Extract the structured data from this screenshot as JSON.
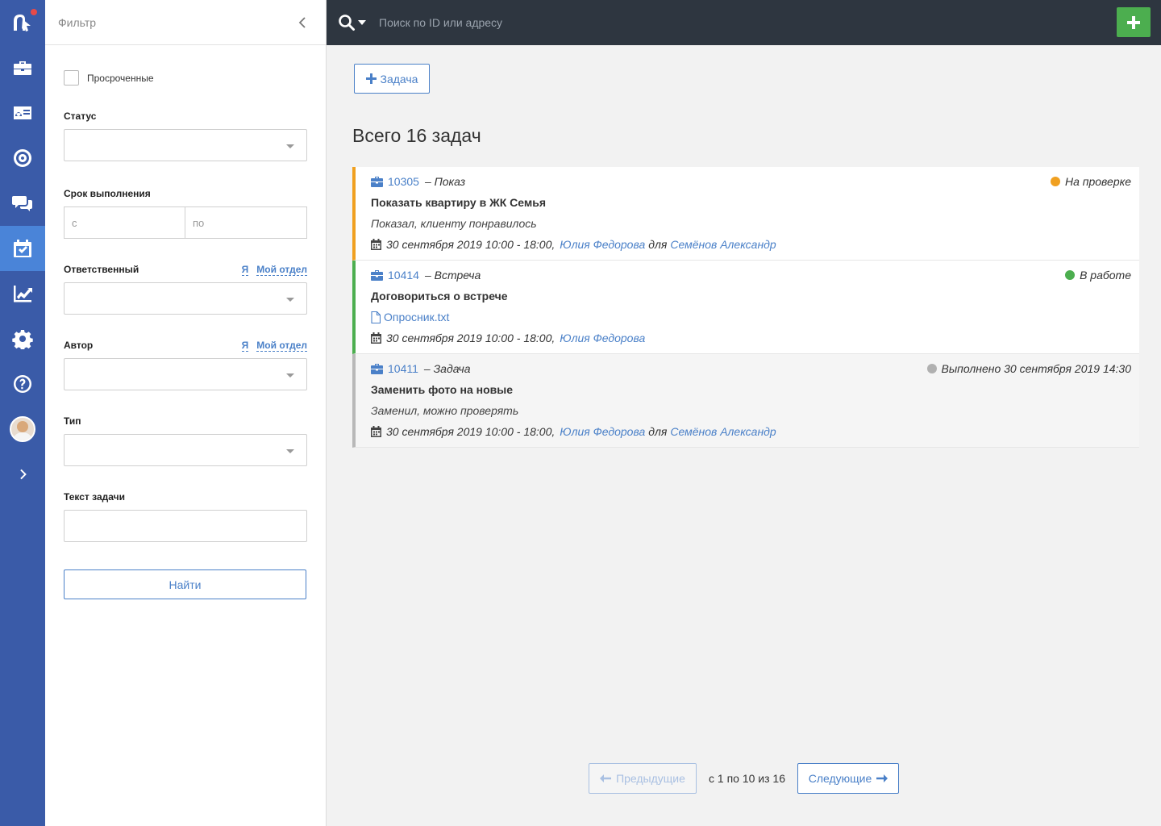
{
  "sidebar": {
    "items": [
      {
        "name": "briefcase-icon"
      },
      {
        "name": "contact-card-icon"
      },
      {
        "name": "target-icon"
      },
      {
        "name": "chat-icon"
      },
      {
        "name": "calendar-check-icon",
        "active": true
      },
      {
        "name": "chart-icon"
      },
      {
        "name": "gear-icon"
      },
      {
        "name": "help-icon"
      },
      {
        "name": "avatar"
      },
      {
        "name": "expand-icon"
      }
    ],
    "accent": "#3a5ba8",
    "active_color": "#4a84d8"
  },
  "filter": {
    "title": "Фильтр",
    "overdue_label": "Просроченные",
    "status_label": "Статус",
    "deadline_label": "Срок выполнения",
    "deadline_from_placeholder": "с",
    "deadline_to_placeholder": "по",
    "responsible_label": "Ответственный",
    "author_label": "Автор",
    "me_link": "Я",
    "my_dept_link": "Мой отдел",
    "type_label": "Тип",
    "text_label": "Текст задачи",
    "find_button": "Найти"
  },
  "topbar": {
    "search_placeholder": "Поиск по ID или адресу",
    "add_label": "+"
  },
  "main": {
    "new_task_button": "Задача",
    "total_title": "Всего 16 задач",
    "tasks": [
      {
        "id": "10305",
        "type": "– Показ",
        "status": "На проверке",
        "status_color": "#f0a020",
        "border_color": "#f0a020",
        "title": "Показать квартиру в ЖК Семья",
        "comment": "Показал, клиенту понравилось",
        "date": "30 сентября 2019 10:00 - 18:00,",
        "assignee": "Юлия Федорова",
        "for_word": "для",
        "client": "Семёнов Александр"
      },
      {
        "id": "10414",
        "type": "– Встреча",
        "status": "В работе",
        "status_color": "#4cae4f",
        "border_color": "#4cae4f",
        "title": "Договориться о встрече",
        "file": "Опросник.txt",
        "date": "30 сентября 2019 10:00 - 18:00,",
        "assignee": "Юлия Федорова"
      },
      {
        "id": "10411",
        "type": "– Задача",
        "status": "Выполнено 30 сентября 2019 14:30",
        "status_color": "#b0b0b0",
        "border_color": "#b8b8b8",
        "title": "Заменить фото на новые",
        "comment": "Заменил, можно проверять",
        "date": "30 сентября 2019 10:00 - 18:00,",
        "assignee": "Юлия Федорова",
        "for_word": "для",
        "client": "Семёнов Александр"
      }
    ]
  },
  "pagination": {
    "prev_label": "Предыдущие",
    "info": "с 1 по 10 из 16",
    "next_label": "Следующие"
  }
}
